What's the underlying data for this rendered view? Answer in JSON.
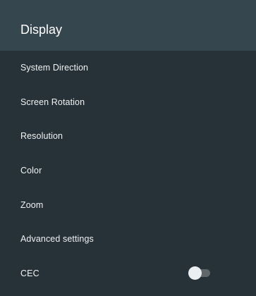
{
  "header": {
    "title": "Display"
  },
  "menu": {
    "items": [
      {
        "label": "System Direction"
      },
      {
        "label": "Screen Rotation"
      },
      {
        "label": "Resolution"
      },
      {
        "label": "Color"
      },
      {
        "label": "Zoom"
      },
      {
        "label": "Advanced settings"
      },
      {
        "label": "CEC",
        "toggle": "off"
      }
    ]
  },
  "colors": {
    "background": "#263238",
    "header_background": "#36464e",
    "toggle_thumb": "#eceff1",
    "toggle_track": "#5f676b"
  }
}
